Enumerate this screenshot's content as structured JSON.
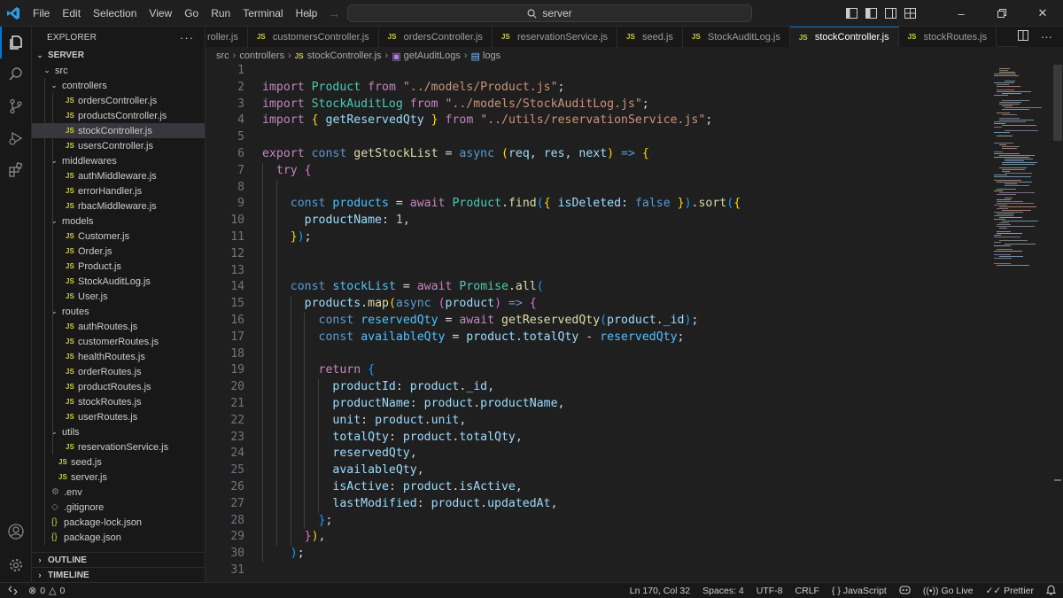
{
  "menu": [
    "File",
    "Edit",
    "Selection",
    "View",
    "Go",
    "Run",
    "Terminal",
    "Help"
  ],
  "command_center": {
    "text": "server"
  },
  "explorer": {
    "title": "EXPLORER",
    "more": "···",
    "root": "SERVER",
    "items": [
      {
        "label": "src",
        "type": "folder",
        "depth": 1
      },
      {
        "label": "controllers",
        "type": "folder",
        "depth": 2
      },
      {
        "label": "ordersController.js",
        "type": "js",
        "depth": 3
      },
      {
        "label": "productsController.js",
        "type": "js",
        "depth": 3
      },
      {
        "label": "stockController.js",
        "type": "js",
        "depth": 3,
        "selected": true
      },
      {
        "label": "usersController.js",
        "type": "js",
        "depth": 3
      },
      {
        "label": "middlewares",
        "type": "folder",
        "depth": 2
      },
      {
        "label": "authMiddleware.js",
        "type": "js",
        "depth": 3
      },
      {
        "label": "errorHandler.js",
        "type": "js",
        "depth": 3
      },
      {
        "label": "rbacMiddleware.js",
        "type": "js",
        "depth": 3
      },
      {
        "label": "models",
        "type": "folder",
        "depth": 2
      },
      {
        "label": "Customer.js",
        "type": "js",
        "depth": 3
      },
      {
        "label": "Order.js",
        "type": "js",
        "depth": 3
      },
      {
        "label": "Product.js",
        "type": "js",
        "depth": 3
      },
      {
        "label": "StockAuditLog.js",
        "type": "js",
        "depth": 3
      },
      {
        "label": "User.js",
        "type": "js",
        "depth": 3
      },
      {
        "label": "routes",
        "type": "folder",
        "depth": 2
      },
      {
        "label": "authRoutes.js",
        "type": "js",
        "depth": 3
      },
      {
        "label": "customerRoutes.js",
        "type": "js",
        "depth": 3
      },
      {
        "label": "healthRoutes.js",
        "type": "js",
        "depth": 3
      },
      {
        "label": "orderRoutes.js",
        "type": "js",
        "depth": 3
      },
      {
        "label": "productRoutes.js",
        "type": "js",
        "depth": 3
      },
      {
        "label": "stockRoutes.js",
        "type": "js",
        "depth": 3
      },
      {
        "label": "userRoutes.js",
        "type": "js",
        "depth": 3
      },
      {
        "label": "utils",
        "type": "folder",
        "depth": 2
      },
      {
        "label": "reservationService.js",
        "type": "js",
        "depth": 3
      },
      {
        "label": "seed.js",
        "type": "js",
        "depth": 2
      },
      {
        "label": "server.js",
        "type": "js",
        "depth": 2
      },
      {
        "label": ".env",
        "type": "gear",
        "depth": 1
      },
      {
        "label": ".gitignore",
        "type": "git",
        "depth": 1
      },
      {
        "label": "package-lock.json",
        "type": "json",
        "depth": 1
      },
      {
        "label": "package.json",
        "type": "json",
        "depth": 1
      }
    ],
    "outline": "OUTLINE",
    "timeline": "TIMELINE"
  },
  "tabs": [
    {
      "label": "roller.js",
      "active": false,
      "badge": false
    },
    {
      "label": "customersController.js",
      "active": false,
      "badge": true
    },
    {
      "label": "ordersController.js",
      "active": false,
      "badge": true
    },
    {
      "label": "reservationService.js",
      "active": false,
      "badge": true
    },
    {
      "label": "seed.js",
      "active": false,
      "badge": true
    },
    {
      "label": "StockAuditLog.js",
      "active": false,
      "badge": true
    },
    {
      "label": "stockController.js",
      "active": true,
      "badge": true
    },
    {
      "label": "stockRoutes.js",
      "active": false,
      "badge": true
    }
  ],
  "js_badge": "JS",
  "breadcrumb": {
    "parts": [
      "src",
      "controllers"
    ],
    "file": "stockController.js",
    "symbol1": "getAuditLogs",
    "symbol2": "logs"
  },
  "code": {
    "lines": [
      [],
      [
        [
          "kw",
          "import"
        ],
        [
          "pl",
          " "
        ],
        [
          "ty",
          "Product"
        ],
        [
          "pl",
          " "
        ],
        [
          "kw",
          "from"
        ],
        [
          "pl",
          " "
        ],
        [
          "str",
          "\"../models/Product.js\""
        ],
        [
          "pl",
          ";"
        ]
      ],
      [
        [
          "kw",
          "import"
        ],
        [
          "pl",
          " "
        ],
        [
          "ty",
          "StockAuditLog"
        ],
        [
          "pl",
          " "
        ],
        [
          "kw",
          "from"
        ],
        [
          "pl",
          " "
        ],
        [
          "str",
          "\"../models/StockAuditLog.js\""
        ],
        [
          "pl",
          ";"
        ]
      ],
      [
        [
          "kw",
          "import"
        ],
        [
          "pl",
          " "
        ],
        [
          "b1",
          "{"
        ],
        [
          "pl",
          " "
        ],
        [
          "var",
          "getReservedQty"
        ],
        [
          "pl",
          " "
        ],
        [
          "b1",
          "}"
        ],
        [
          "pl",
          " "
        ],
        [
          "kw",
          "from"
        ],
        [
          "pl",
          " "
        ],
        [
          "str",
          "\"../utils/reservationService.js\""
        ],
        [
          "pl",
          ";"
        ]
      ],
      [],
      [
        [
          "kw",
          "export"
        ],
        [
          "pl",
          " "
        ],
        [
          "bool",
          "const"
        ],
        [
          "pl",
          " "
        ],
        [
          "fn",
          "getStockList"
        ],
        [
          "pl",
          " = "
        ],
        [
          "bool",
          "async"
        ],
        [
          "pl",
          " "
        ],
        [
          "b1",
          "("
        ],
        [
          "var",
          "req"
        ],
        [
          "pl",
          ", "
        ],
        [
          "var",
          "res"
        ],
        [
          "pl",
          ", "
        ],
        [
          "var",
          "next"
        ],
        [
          "b1",
          ")"
        ],
        [
          "pl",
          " "
        ],
        [
          "bool",
          "=>"
        ],
        [
          "pl",
          " "
        ],
        [
          "b1",
          "{"
        ]
      ],
      [
        [
          "pl",
          "  "
        ],
        [
          "kw",
          "try"
        ],
        [
          "pl",
          " "
        ],
        [
          "b2",
          "{"
        ]
      ],
      [],
      [
        [
          "pl",
          "    "
        ],
        [
          "bool",
          "const"
        ],
        [
          "pl",
          " "
        ],
        [
          "con",
          "products"
        ],
        [
          "pl",
          " = "
        ],
        [
          "kw",
          "await"
        ],
        [
          "pl",
          " "
        ],
        [
          "ty",
          "Product"
        ],
        [
          "pl",
          "."
        ],
        [
          "fn",
          "find"
        ],
        [
          "b3",
          "("
        ],
        [
          "b1",
          "{"
        ],
        [
          "pl",
          " "
        ],
        [
          "var",
          "isDeleted"
        ],
        [
          "pl",
          ": "
        ],
        [
          "bool",
          "false"
        ],
        [
          "pl",
          " "
        ],
        [
          "b1",
          "}"
        ],
        [
          "b3",
          ")"
        ],
        [
          "pl",
          "."
        ],
        [
          "fn",
          "sort"
        ],
        [
          "b3",
          "("
        ],
        [
          "b1",
          "{"
        ]
      ],
      [
        [
          "pl",
          "      "
        ],
        [
          "var",
          "productName"
        ],
        [
          "pl",
          ": "
        ],
        [
          "num",
          "1"
        ],
        [
          "pl",
          ","
        ]
      ],
      [
        [
          "pl",
          "    "
        ],
        [
          "b1",
          "}"
        ],
        [
          "b3",
          ")"
        ],
        [
          "pl",
          ";"
        ]
      ],
      [],
      [],
      [
        [
          "pl",
          "    "
        ],
        [
          "bool",
          "const"
        ],
        [
          "pl",
          " "
        ],
        [
          "con",
          "stockList"
        ],
        [
          "pl",
          " = "
        ],
        [
          "kw",
          "await"
        ],
        [
          "pl",
          " "
        ],
        [
          "ty",
          "Promise"
        ],
        [
          "pl",
          "."
        ],
        [
          "fn",
          "all"
        ],
        [
          "b3",
          "("
        ]
      ],
      [
        [
          "pl",
          "      "
        ],
        [
          "var",
          "products"
        ],
        [
          "pl",
          "."
        ],
        [
          "fn",
          "map"
        ],
        [
          "b1",
          "("
        ],
        [
          "bool",
          "async"
        ],
        [
          "pl",
          " "
        ],
        [
          "b2",
          "("
        ],
        [
          "var",
          "product"
        ],
        [
          "b2",
          ")"
        ],
        [
          "pl",
          " "
        ],
        [
          "bool",
          "=>"
        ],
        [
          "pl",
          " "
        ],
        [
          "b2",
          "{"
        ]
      ],
      [
        [
          "pl",
          "        "
        ],
        [
          "bool",
          "const"
        ],
        [
          "pl",
          " "
        ],
        [
          "con",
          "reservedQty"
        ],
        [
          "pl",
          " = "
        ],
        [
          "kw",
          "await"
        ],
        [
          "pl",
          " "
        ],
        [
          "fn",
          "getReservedQty"
        ],
        [
          "b3",
          "("
        ],
        [
          "var",
          "product"
        ],
        [
          "pl",
          "."
        ],
        [
          "var",
          "_id"
        ],
        [
          "b3",
          ")"
        ],
        [
          "pl",
          ";"
        ]
      ],
      [
        [
          "pl",
          "        "
        ],
        [
          "bool",
          "const"
        ],
        [
          "pl",
          " "
        ],
        [
          "con",
          "availableQty"
        ],
        [
          "pl",
          " = "
        ],
        [
          "var",
          "product"
        ],
        [
          "pl",
          "."
        ],
        [
          "var",
          "totalQty"
        ],
        [
          "pl",
          " - "
        ],
        [
          "con",
          "reservedQty"
        ],
        [
          "pl",
          ";"
        ]
      ],
      [],
      [
        [
          "pl",
          "        "
        ],
        [
          "kw",
          "return"
        ],
        [
          "pl",
          " "
        ],
        [
          "b3",
          "{"
        ]
      ],
      [
        [
          "pl",
          "          "
        ],
        [
          "var",
          "productId"
        ],
        [
          "pl",
          ": "
        ],
        [
          "var",
          "product"
        ],
        [
          "pl",
          "."
        ],
        [
          "var",
          "_id"
        ],
        [
          "pl",
          ","
        ]
      ],
      [
        [
          "pl",
          "          "
        ],
        [
          "var",
          "productName"
        ],
        [
          "pl",
          ": "
        ],
        [
          "var",
          "product"
        ],
        [
          "pl",
          "."
        ],
        [
          "var",
          "productName"
        ],
        [
          "pl",
          ","
        ]
      ],
      [
        [
          "pl",
          "          "
        ],
        [
          "var",
          "unit"
        ],
        [
          "pl",
          ": "
        ],
        [
          "var",
          "product"
        ],
        [
          "pl",
          "."
        ],
        [
          "var",
          "unit"
        ],
        [
          "pl",
          ","
        ]
      ],
      [
        [
          "pl",
          "          "
        ],
        [
          "var",
          "totalQty"
        ],
        [
          "pl",
          ": "
        ],
        [
          "var",
          "product"
        ],
        [
          "pl",
          "."
        ],
        [
          "var",
          "totalQty"
        ],
        [
          "pl",
          ","
        ]
      ],
      [
        [
          "pl",
          "          "
        ],
        [
          "var",
          "reservedQty"
        ],
        [
          "pl",
          ","
        ]
      ],
      [
        [
          "pl",
          "          "
        ],
        [
          "var",
          "availableQty"
        ],
        [
          "pl",
          ","
        ]
      ],
      [
        [
          "pl",
          "          "
        ],
        [
          "var",
          "isActive"
        ],
        [
          "pl",
          ": "
        ],
        [
          "var",
          "product"
        ],
        [
          "pl",
          "."
        ],
        [
          "var",
          "isActive"
        ],
        [
          "pl",
          ","
        ]
      ],
      [
        [
          "pl",
          "          "
        ],
        [
          "var",
          "lastModified"
        ],
        [
          "pl",
          ": "
        ],
        [
          "var",
          "product"
        ],
        [
          "pl",
          "."
        ],
        [
          "var",
          "updatedAt"
        ],
        [
          "pl",
          ","
        ]
      ],
      [
        [
          "pl",
          "        "
        ],
        [
          "b3",
          "}"
        ],
        [
          "pl",
          ";"
        ]
      ],
      [
        [
          "pl",
          "      "
        ],
        [
          "b2",
          "}"
        ],
        [
          "b1",
          ")"
        ],
        [
          "pl",
          ","
        ]
      ],
      [
        [
          "pl",
          "    "
        ],
        [
          "b3",
          ")"
        ],
        [
          "pl",
          ";"
        ]
      ],
      []
    ]
  },
  "status": {
    "errors": "0",
    "warnings": "0",
    "position": "Ln 170, Col 32",
    "spaces": "Spaces: 4",
    "encoding": "UTF-8",
    "eol": "CRLF",
    "language": "JavaScript",
    "golive": "Go Live",
    "prettier": "Prettier"
  },
  "colors": {
    "accent": "#0078d4",
    "js": "#cbcb41",
    "background": "#1f1f1f",
    "sidebar": "#181818"
  }
}
